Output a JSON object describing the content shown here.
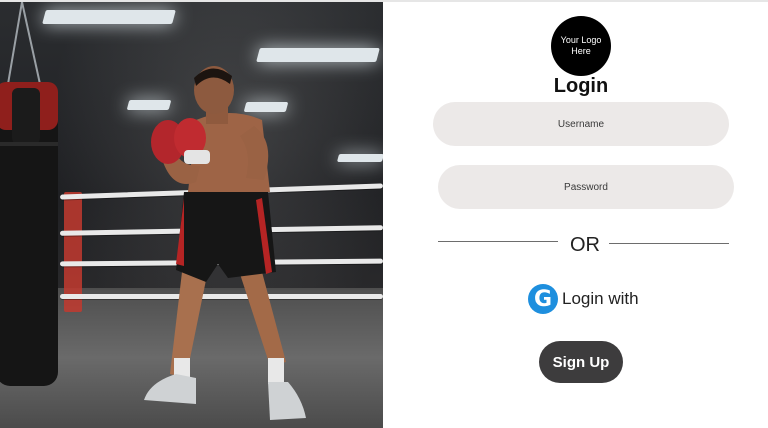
{
  "logo": {
    "text": "Your Logo Here"
  },
  "login": {
    "title": "Login",
    "username_placeholder": "Username",
    "password_placeholder": "Password",
    "divider_text": "OR",
    "google_icon": "google-g-icon",
    "google_icon_glyph": "G",
    "google_label": "Login with",
    "signup_label": "Sign Up"
  },
  "colors": {
    "logo_bg": "#000000",
    "field_bg": "#ece9e8",
    "google_blue": "#1e8fde",
    "signup_bg": "#3d3c3d"
  }
}
